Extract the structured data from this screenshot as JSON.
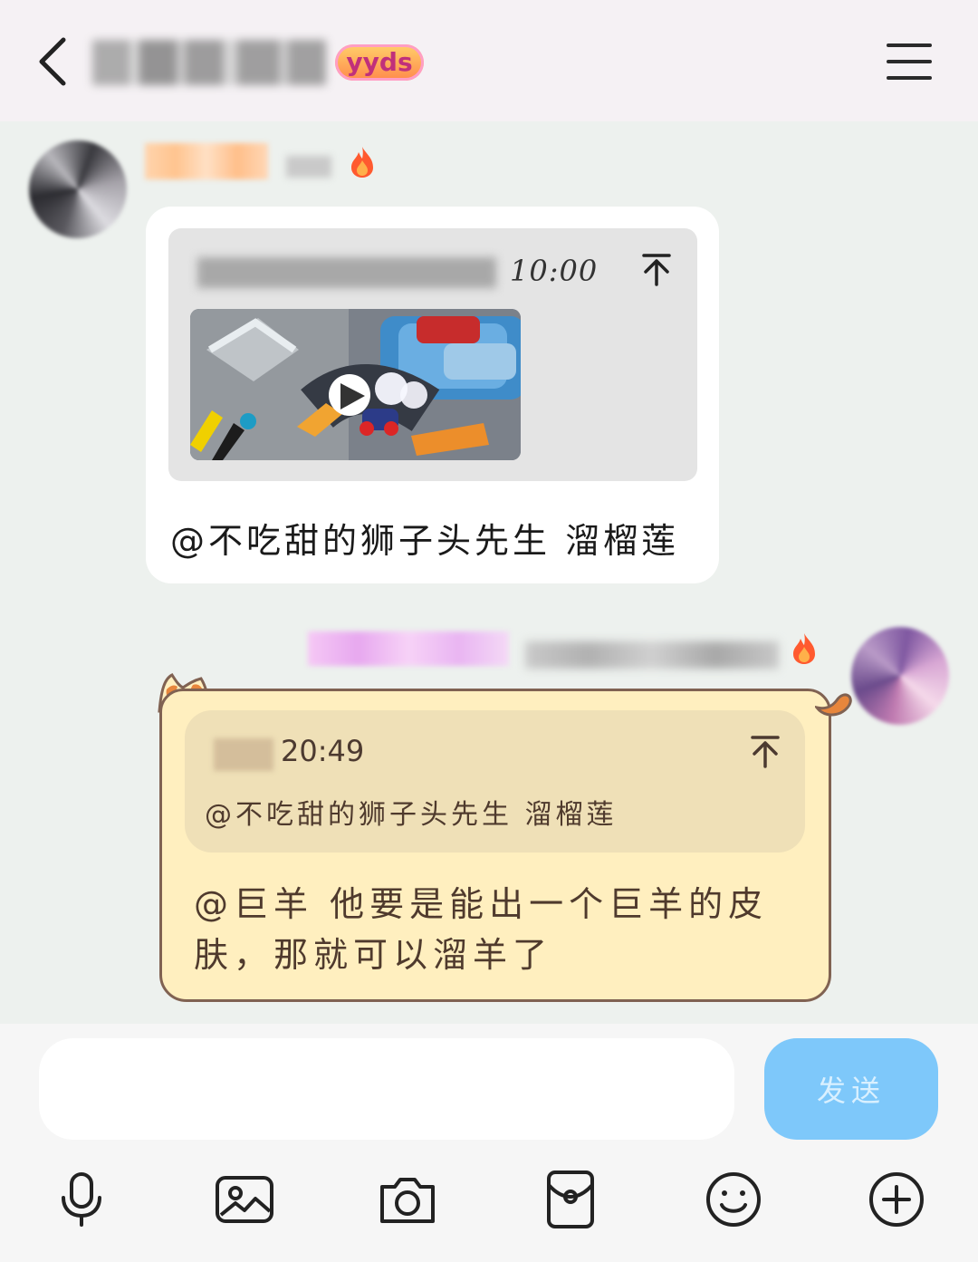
{
  "header": {
    "badge_text": "yyds",
    "icons": [
      "chevron-left-icon",
      "hamburger-menu-icon"
    ]
  },
  "messages": [
    {
      "side": "left",
      "quoted_time": "10:00",
      "text": "@不吃甜的狮子头先生 溜榴莲"
    },
    {
      "side": "right",
      "reply_time": "20:49",
      "reply_text": "@不吃甜的狮子头先生 溜榴莲",
      "text": "@巨羊 他要是能出一个巨羊的皮肤，那就可以溜羊了"
    }
  ],
  "composer": {
    "input_value": "",
    "send_label": "发送"
  },
  "toolbar_icons": [
    "microphone-icon",
    "image-icon",
    "camera-icon",
    "red-packet-icon",
    "emoji-icon",
    "plus-icon"
  ],
  "colors": {
    "accent_blue": "#7ec8fa",
    "chat_background": "#edf1ee",
    "cat_bubble": "#ffefbf"
  }
}
